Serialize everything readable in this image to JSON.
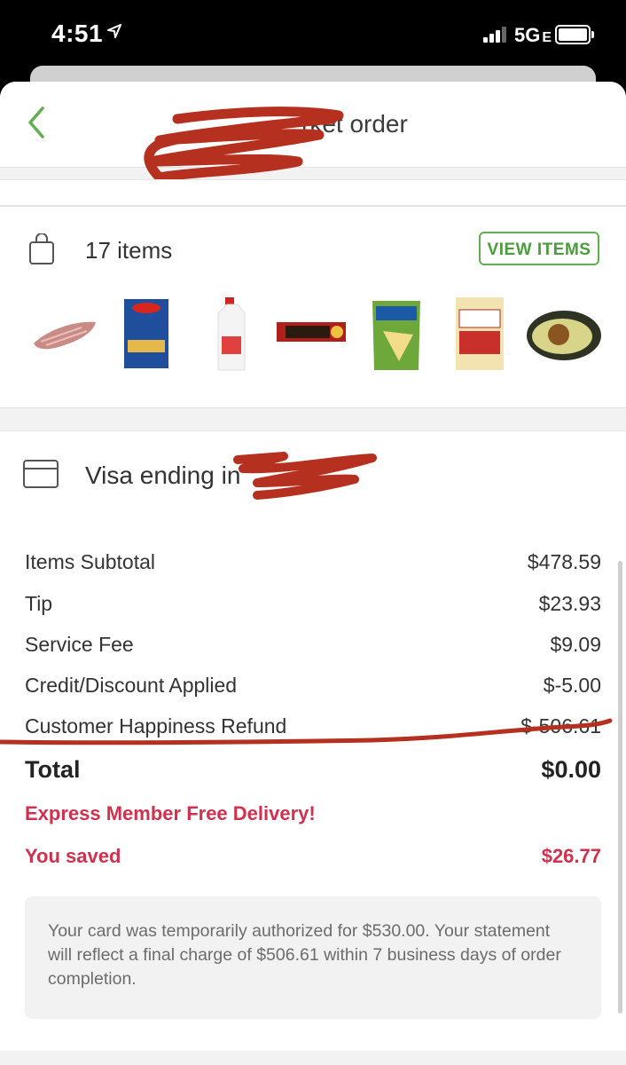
{
  "status_bar": {
    "time": "4:51",
    "network": "5G",
    "network_suffix": "E"
  },
  "header": {
    "title_visible": "rket order"
  },
  "order": {
    "item_count_label": "17 items",
    "view_items_label": "VIEW ITEMS",
    "thumbnails": [
      "meat-tenderloin",
      "barilla-elbows-pasta",
      "milk-jug",
      "cracker-barrel-cheese",
      "tostitos-chips",
      "panko-bread-crumbs",
      "avocado"
    ]
  },
  "payment": {
    "card_label": "Visa ending in"
  },
  "summary": {
    "lines": [
      {
        "label": "Items Subtotal",
        "value": "$478.59"
      },
      {
        "label": "Tip",
        "value": "$23.93"
      },
      {
        "label": "Service Fee",
        "value": "$9.09"
      },
      {
        "label": "Credit/Discount Applied",
        "value": "$-5.00"
      },
      {
        "label": "Customer Happiness Refund",
        "value": "$-506.61"
      }
    ],
    "total_label": "Total",
    "total_value": "$0.00",
    "promo": "Express Member Free Delivery!",
    "saved_label": "You saved",
    "saved_value": "$26.77",
    "note": "Your card was temporarily authorized for $530.00. Your statement will reflect a final charge of $506.61 within 7 business days of order completion."
  },
  "colors": {
    "accent_green": "#5fb14f",
    "promo_red": "#d0314f",
    "scribble_red": "#b5301f"
  }
}
